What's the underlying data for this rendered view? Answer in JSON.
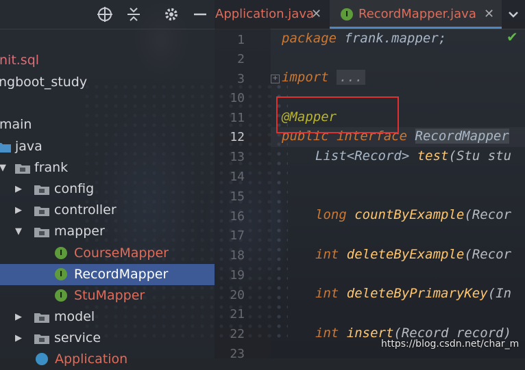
{
  "sidebar": {
    "toolbar_icons": [
      "target-icon",
      "collapse-icon",
      "gear-icon",
      "minimize-icon"
    ],
    "items": [
      {
        "label": "nit.sql",
        "color": "#e06c75"
      },
      {
        "label": "ngboot_study",
        "color": "#d8dade"
      },
      {
        "label": "main",
        "color": "#d8dade"
      },
      {
        "label": "java",
        "color": "#d8dade"
      },
      {
        "label": "frank",
        "color": "#d8dade"
      },
      {
        "label": "config",
        "color": "#d8dade"
      },
      {
        "label": "controller",
        "color": "#d8dade"
      },
      {
        "label": "mapper",
        "color": "#d8dade"
      },
      {
        "label": "CourseMapper",
        "color": "#e06c5a"
      },
      {
        "label": "RecordMapper",
        "color": "#ffffff"
      },
      {
        "label": "StuMapper",
        "color": "#e06c5a"
      },
      {
        "label": "model",
        "color": "#d8dade"
      },
      {
        "label": "service",
        "color": "#d8dade"
      },
      {
        "label": "Application",
        "color": "#e06c5a"
      }
    ]
  },
  "tabs": [
    {
      "label": "Application.java",
      "color": "#e06c5a"
    },
    {
      "label": "RecordMapper.java",
      "color": "#e06c5a"
    }
  ],
  "gutter": [
    "1",
    "2",
    "3",
    "10",
    "11",
    "12",
    "13",
    "14",
    "15",
    "16",
    "17",
    "18",
    "19",
    "20",
    "21",
    "22",
    "23"
  ],
  "code": {
    "package_kw": "package",
    "package_name": "frank.mapper;",
    "import_kw": "import",
    "import_fold": "...",
    "annotation": "@Mapper",
    "public_kw": "public",
    "interface_kw": "interface",
    "interface_name": "RecordMapper",
    "line13_type": "List<Record>",
    "line13_fn": "test",
    "line13_args": "(Stu stu",
    "line16_kw": "long",
    "line16_fn": "countByExample",
    "line16_args": "(Recor",
    "line18_kw": "int",
    "line18_fn": "deleteByExample",
    "line18_args": "(Recor",
    "line20_kw": "int",
    "line20_fn": "deleteByPrimaryKey",
    "line20_args": "(In",
    "line22_kw": "int",
    "line22_fn": "insert",
    "line22_args": "(Record record)"
  },
  "watermark": "https://blog.csdn.net/char_m",
  "colors": {
    "accent_selected": "#3d5a96",
    "highlight_box": "#e03030",
    "check": "#5fb84b"
  }
}
